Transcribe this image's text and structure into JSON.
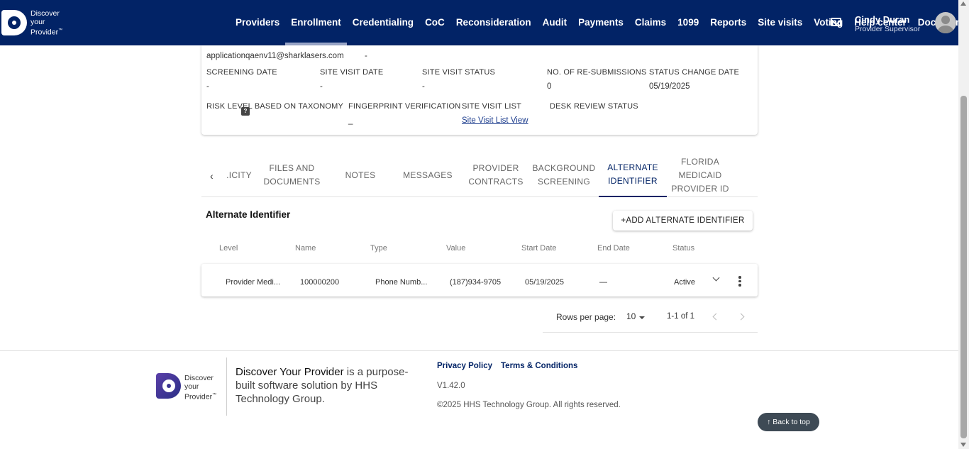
{
  "app": {
    "logo_line1": "Discover",
    "logo_line2": "your",
    "logo_line3": "Provider",
    "logo_tm": "™"
  },
  "nav": {
    "items": [
      "Providers",
      "Enrollment",
      "Credentialing",
      "CoC",
      "Reconsideration",
      "Audit",
      "Payments",
      "Claims",
      "1099",
      "Reports",
      "Site visits",
      "Voting",
      "Help center",
      "Documents"
    ],
    "active": "Enrollment"
  },
  "user": {
    "name": "Cindy Duran",
    "role": "Provider Supervisor"
  },
  "details": {
    "email": "applicationqaenv11@sharklasers.com",
    "email_extra": "-",
    "screening_date_label": "SCREENING DATE",
    "screening_date": "-",
    "site_visit_date_label": "SITE VISIT DATE",
    "site_visit_date": "-",
    "site_visit_status_label": "SITE VISIT STATUS",
    "site_visit_status": "-",
    "resubmissions_label": "NO. OF RE-SUBMISSIONS",
    "resubmissions": "0",
    "status_change_label": "STATUS CHANGE DATE",
    "status_change": "05/19/2025",
    "risk_label": "RISK LEVEL BASED ON TAXONOMY",
    "risk_help": "?",
    "fingerprint_label": "FINGERPRINT VERIFICATION",
    "fingerprint": "_",
    "site_visit_list_label": "SITE VISIT LIST",
    "site_visit_list_link": "Site Visit List View",
    "desk_review_label": "DESK REVIEW STATUS"
  },
  "tabs": {
    "prev_icon": "chevron-left-icon",
    "items": [
      {
        "line1": ".ICITY",
        "line2": "",
        "line3": ""
      },
      {
        "line1": "FILES AND",
        "line2": "DOCUMENTS",
        "line3": ""
      },
      {
        "line1": "NOTES",
        "line2": "",
        "line3": ""
      },
      {
        "line1": "MESSAGES",
        "line2": "",
        "line3": ""
      },
      {
        "line1": "PROVIDER",
        "line2": "CONTRACTS",
        "line3": ""
      },
      {
        "line1": "BACKGROUND",
        "line2": "SCREENING",
        "line3": ""
      },
      {
        "line1": "ALTERNATE",
        "line2": "IDENTIFIER",
        "line3": ""
      },
      {
        "line1": "FLORIDA",
        "line2": "MEDICAID",
        "line3": "PROVIDER ID"
      }
    ],
    "active_index": 6
  },
  "alternate": {
    "title": "Alternate Identifier",
    "add_button": "+ADD ALTERNATE IDENTIFIER",
    "columns": [
      "Level",
      "Name",
      "Type",
      "Value",
      "Start Date",
      "End Date",
      "Status"
    ],
    "rows": [
      {
        "level": "Provider Medi...",
        "name": "100000200",
        "type": "Phone Numb...",
        "value": "(187)934-9705",
        "start": "05/19/2025",
        "end": "—",
        "status": "Active"
      }
    ]
  },
  "pagination": {
    "rows_per_page_label": "Rows per page:",
    "rows_per_page": "10",
    "range": "1-1 of 1"
  },
  "footer": {
    "brand": "Discover Your Provider",
    "tagline_rest": " is a purpose-built software solution by HHS Technology Group.",
    "privacy": "Privacy Policy",
    "terms": "Terms & Conditions",
    "version": "V1.42.0",
    "copyright": "©2025 HHS Technology Group. All rights reserved.",
    "back_to_top": "↑ Back to top"
  },
  "colors": {
    "nav_bg": "#022366",
    "accent": "#022366",
    "back_to_top_bg": "#3e4a55"
  }
}
